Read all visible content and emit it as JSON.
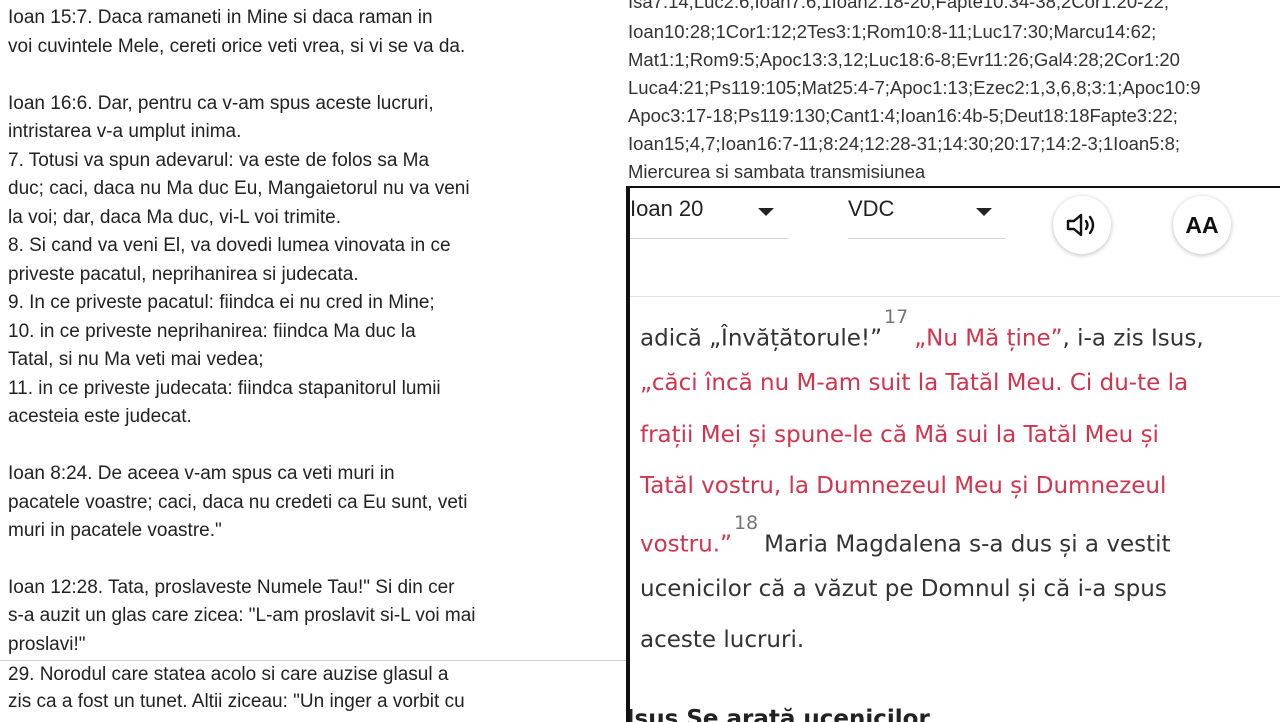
{
  "left_doc": {
    "lines": [
      "    Ioan 15:7. Daca ramaneti in Mine si daca raman in",
      "voi cuvintele Mele, cereti orice veti vrea, si vi se va da.",
      "    Ioan 16:6. Dar, pentru ca v-am spus aceste lucruri,",
      "intristarea v-a umplut inima.",
      "    7. Totusi va spun adevarul: va este de folos sa Ma",
      "duc; caci, daca nu Ma duc Eu, Mangaietorul nu va veni",
      "la voi; dar, daca Ma duc, vi-L voi trimite.",
      "    8. Si cand va veni El, va dovedi lumea vinovata in ce",
      "priveste pacatul, neprihanirea si judecata.",
      "    9. In ce priveste pacatul: fiindca ei nu cred in Mine;",
      "    10. in ce priveste neprihanirea: fiindca Ma duc la",
      "Tatal, si nu Ma veti mai vedea;",
      "    11. in ce priveste judecata: fiindca stapanitorul lumii",
      "acesteia este judecat.",
      "    Ioan 8:24. De aceea v-am spus ca veti muri in",
      "pacatele voastre; caci, daca nu credeti ca Eu sunt, veti",
      "muri in pacatele voastre.\"",
      "    Ioan 12:28. Tata, proslaveste Numele Tau!\" Si din cer",
      "s-a auzit un glas care zicea: \"L-am proslavit si-L voi mai",
      "proslavi!\"",
      "    29. Norodul care statea acolo si care auzise glasul a",
      "zis ca a fost un tunet. Altii ziceau: \"Un inger a vorbit cu"
    ]
  },
  "refs": {
    "lines": [
      "Isa7:14;Luc2:6;Ioan7:6;1Ioan2:18-20;Fapte10:34-38;2Cor1:20-22;",
      "Ioan10:28;1Cor1:12;2Tes3:1;Rom10:8-11;Luc17:30;Marcu14:62;",
      "Mat1:1;Rom9:5;Apoc13:3,12;Luc18:6-8;Evr11:26;Gal4:28;2Cor1:20",
      "Luca4:21;Ps119:105;Mat25:4-7;Apoc1:13;Ezec2:1,3,6,8;3:1;Apoc10:9",
      "Apoc3:17-18;Ps119:130;Cant1:4;Ioan16:4b-5;Deut18:18Fapte3:22;",
      "Ioan15;4,7;Ioan16:7-11;8:24;12:28-31;14:30;20:17;14:2-3;1Ioan5:8;",
      "Miercurea si sambata transmisiunea"
    ]
  },
  "app": {
    "chapter_select": "Ioan 20",
    "version_select": "VDC",
    "audio_icon": "speaker-icon",
    "font_size_label": "AA",
    "verses": {
      "l1_black": "adică „Învățătorule!”",
      "vn17": "17",
      "l1_red": "„Nu Mă ține”",
      "l1_tail": ", i-a zis Isus,",
      "l2": "„căci încă nu M-am suit la Tatăl Meu. Ci du-te la",
      "l3": "frații Mei și spune-le că Mă sui la Tatăl Meu și",
      "l4": "Tatăl vostru, la Dumnezeul Meu și Dumnezeul",
      "l5_red": "vostru.”",
      "vn18": "18",
      "l5_black": "Maria Magdalena s-a dus și a vestit",
      "l6": "ucenicilor că a văzut pe Domnul și că i-a spus",
      "l7": "aceste lucruri."
    },
    "section_heading": "Isus Se arată ucenicilor"
  },
  "colors": {
    "words_of_jesus": "#d2334d",
    "verse_number": "#777777",
    "window_border": "#111111"
  }
}
